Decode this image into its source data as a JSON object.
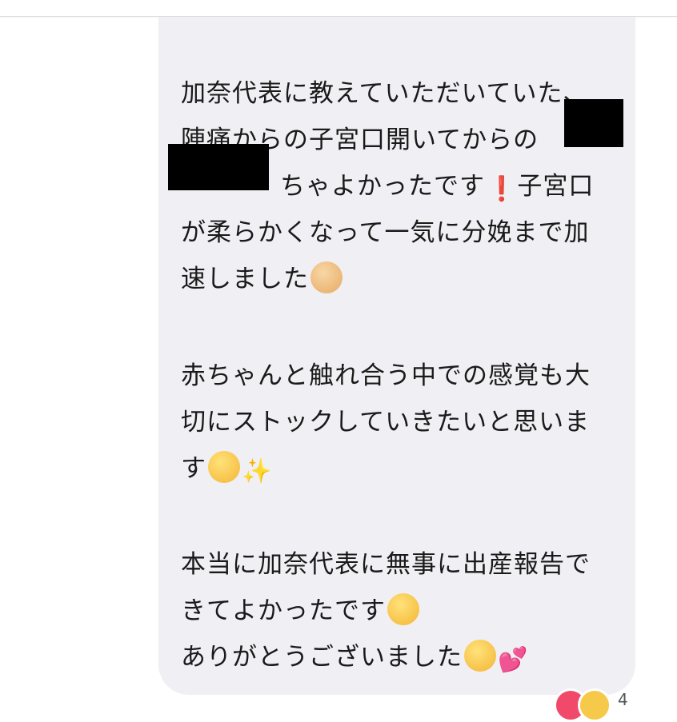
{
  "message": {
    "paragraph1": [
      "加奈代表に教えていただいていた、",
      "陣痛からの子宮口開いてからの",
      "ちゃよかったです",
      "子宮口",
      "が柔らかくなって一気に分娩まで加",
      "速しました"
    ],
    "paragraph2": [
      "赤ちゃんと触れ合う中での感覚も大",
      "切にストックしていきたいと思いま",
      "す"
    ],
    "paragraph3": [
      "本当に加奈代表に無事に出産報告で",
      "きてよかったです",
      "ありがとうございました"
    ],
    "emoji_exclaim": "❗",
    "emoji_sparkles": "✨",
    "emoji_hearts": "💕"
  },
  "reactions": {
    "icons": [
      "heart-icon",
      "smiling-face-icon"
    ],
    "count": "4"
  },
  "colors": {
    "bubble": "#efeff4",
    "text": "#1a1a1a",
    "reaction_heart": "#f0496a"
  }
}
